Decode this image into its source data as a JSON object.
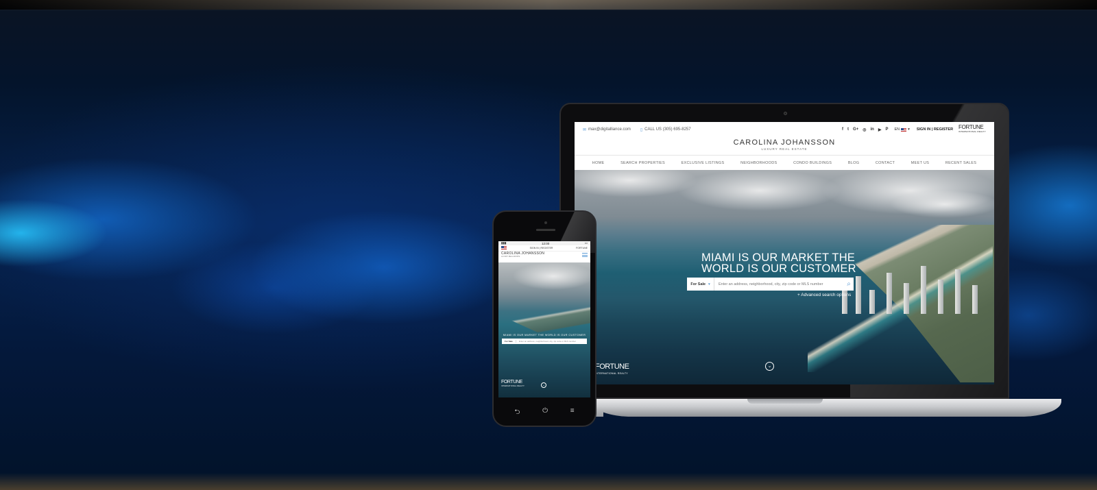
{
  "laptop_site": {
    "email": "max@digitalliance.com",
    "phone": "CALL US (305) 695-8257",
    "social_icons": [
      "facebook-icon",
      "twitter-icon",
      "google-plus-icon",
      "instagram-icon",
      "linkedin-icon",
      "youtube-icon",
      "pinterest-icon"
    ],
    "social_glyphs": [
      "f",
      "t",
      "G+",
      "◎",
      "in",
      "▶",
      "P"
    ],
    "language": "EN",
    "auth": "SIGN IN | REGISTER",
    "partner_logo": "FORTUNE",
    "partner_sub": "INTERNATIONAL REALTY",
    "brand_name": "CAROLINA JOHANSSON",
    "brand_sub": "LUXURY REAL ESTATE",
    "nav": [
      "HOME",
      "SEARCH PROPERTIES",
      "EXCLUSIVE LISTINGS",
      "NEIGHBORHOODS",
      "CONDO BUILDINGS",
      "BLOG",
      "CONTACT",
      "MEET US",
      "RECENT SALES"
    ],
    "hero_line1": "MIAMI IS OUR MARKET THE",
    "hero_line2": "WORLD IS OUR CUSTOMER",
    "search_select": "For Sale",
    "search_placeholder": "Enter an address, neighborhood, city, zip code or MLS number",
    "advanced": "+ Advanced search options",
    "hero_logo": "FORTUNE",
    "hero_logo_sub": "INTERNATIONAL REALTY"
  },
  "phone_site": {
    "time": "12:00",
    "auth": "SIGN IN | REGISTER",
    "partner_logo": "FORTUNE",
    "brand_name": "CAROLINA JOHANSSON",
    "brand_sub": "LUXURY REAL ESTATE",
    "hero_title": "MIAMI IS OUR MARKET THE WORLD IS OUR CUSTOMER",
    "search_select": "For Sale",
    "search_placeholder": "Enter an address, neighborhood, city, zip code or MLS number",
    "hero_logo": "FORTUNE",
    "hero_logo_sub": "INTERNATIONAL REALTY",
    "buttons": [
      "back-icon",
      "power-icon",
      "menu-icon"
    ],
    "button_glyphs": [
      "⮌",
      "⏻",
      "≡"
    ]
  },
  "colors": {
    "accent": "#5b9bd5",
    "background": "#04183a"
  }
}
